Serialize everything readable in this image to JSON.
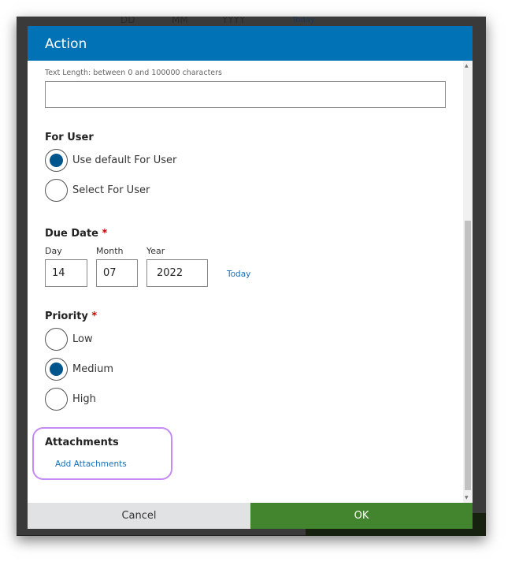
{
  "background": {
    "day_placeholder": "DD",
    "month_placeholder": "MM",
    "year_placeholder": "YYYY",
    "today": "Today"
  },
  "dialog": {
    "title": "Action",
    "text_hint": "Text Length: between 0 and 100000 characters",
    "text_value": "",
    "for_user": {
      "label": "For User",
      "options": [
        {
          "label": "Use default For User",
          "selected": true
        },
        {
          "label": "Select For User",
          "selected": false
        }
      ]
    },
    "due_date": {
      "label": "Due Date",
      "required": "*",
      "day_label": "Day",
      "month_label": "Month",
      "year_label": "Year",
      "day": "14",
      "month": "07",
      "year": "2022",
      "today": "Today"
    },
    "priority": {
      "label": "Priority",
      "required": "*",
      "options": [
        {
          "label": "Low",
          "selected": false
        },
        {
          "label": "Medium",
          "selected": true
        },
        {
          "label": "High",
          "selected": false
        }
      ]
    },
    "attachments": {
      "label": "Attachments",
      "add": "Add Attachments"
    },
    "cancel": "Cancel",
    "ok": "OK"
  },
  "colors": {
    "header": "#0072b5",
    "ok": "#43852f",
    "highlight": "#c58bf5",
    "radio": "#00558c"
  }
}
